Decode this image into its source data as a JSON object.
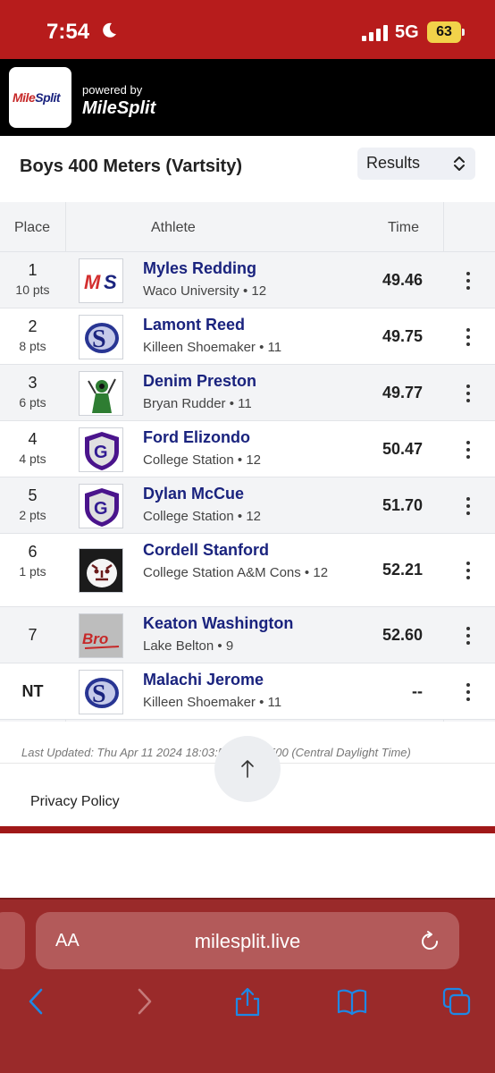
{
  "status_bar": {
    "time": "7:54",
    "network": "5G",
    "battery": "63"
  },
  "header": {
    "logo_text_a": "Mile",
    "logo_text_b": "Split",
    "powered_by": "powered by",
    "brand_name": "MileSplit"
  },
  "event": {
    "title": "Boys 400 Meters (Vartsity)",
    "view_select": "Results"
  },
  "table": {
    "columns": {
      "place": "Place",
      "athlete": "Athlete",
      "time": "Time"
    },
    "rows": [
      {
        "place": "1",
        "points": "10 pts",
        "name": "Myles Redding",
        "team": "Waco University • 12",
        "mark": "49.46",
        "logo": "ms-logo"
      },
      {
        "place": "2",
        "points": "8 pts",
        "name": "Lamont Reed",
        "team": "Killeen Shoemaker • 11",
        "mark": "49.75",
        "logo": "shoemaker-logo"
      },
      {
        "place": "3",
        "points": "6 pts",
        "name": "Denim Preston",
        "team": "Bryan Rudder • 11",
        "mark": "49.77",
        "logo": "rudder-logo"
      },
      {
        "place": "4",
        "points": "4 pts",
        "name": "Ford Elizondo",
        "team": "College Station • 12",
        "mark": "50.47",
        "logo": "college-station-logo"
      },
      {
        "place": "5",
        "points": "2 pts",
        "name": "Dylan McCue",
        "team": "College Station • 12",
        "mark": "51.70",
        "logo": "college-station-logo"
      },
      {
        "place": "6",
        "points": "1 pts",
        "name": "Cordell Stanford",
        "team": "College Station A&M Cons • 12",
        "mark": "52.21",
        "logo": "tiger-logo"
      },
      {
        "place": "7",
        "points": "",
        "name": "Keaton Washington",
        "team": "Lake Belton • 9",
        "mark": "52.60",
        "logo": "broncos-logo"
      },
      {
        "place": "NT",
        "points": "",
        "name": "Malachi Jerome",
        "team": "Killeen Shoemaker • 11",
        "mark": "--",
        "logo": "shoemaker-logo"
      }
    ]
  },
  "footer": {
    "last_updated": "Last Updated: Thu Apr 11 2024 18:03:56 GMT-0500 (Central Daylight Time)",
    "privacy": "Privacy Policy"
  },
  "browser": {
    "aa": "AA",
    "url": "milesplit.live"
  },
  "colors": {
    "brand_red": "#b71c1c",
    "name_navy": "#1a237e",
    "browser_red": "#9a2a2a"
  }
}
